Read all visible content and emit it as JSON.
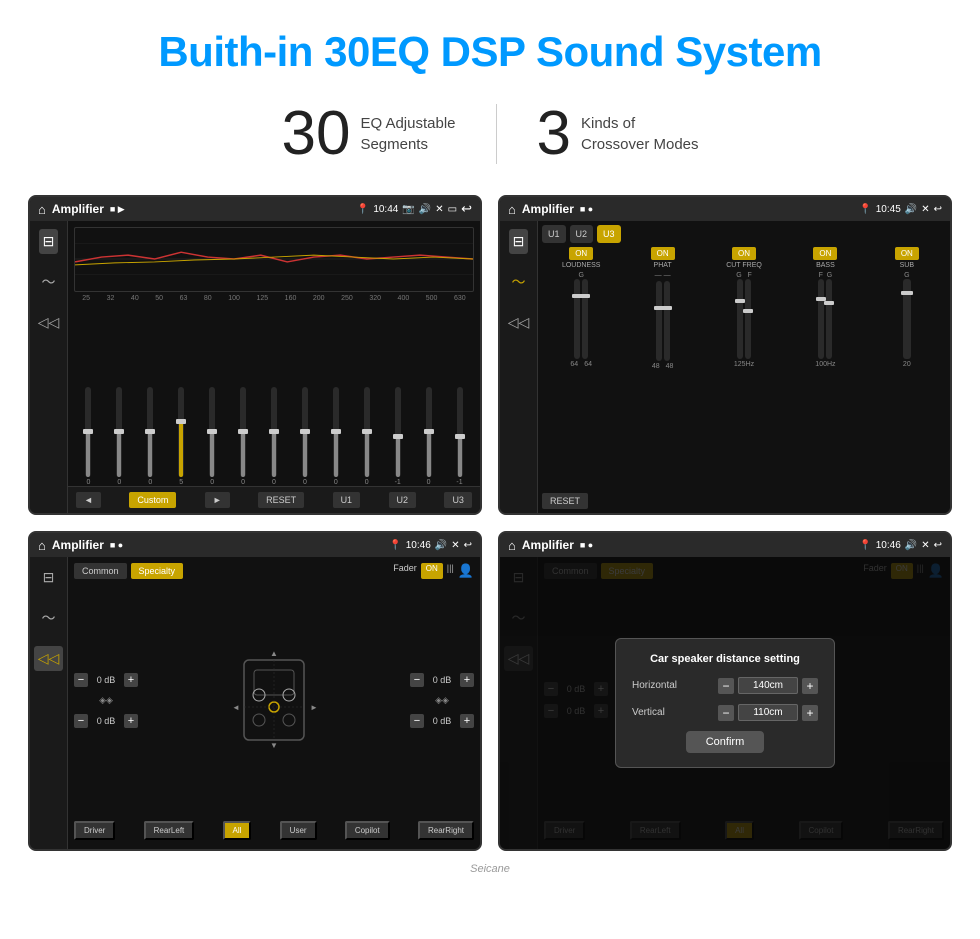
{
  "page": {
    "title": "Buith-in 30EQ DSP Sound System",
    "stats": [
      {
        "number": "30",
        "text": "EQ Adjustable\nSegments"
      },
      {
        "number": "3",
        "text": "Kinds of\nCrossover Modes"
      }
    ]
  },
  "screens": [
    {
      "id": "screen1",
      "status_time": "10:44",
      "app_title": "Amplifier",
      "type": "eq",
      "freq_labels": [
        "25",
        "32",
        "40",
        "50",
        "63",
        "80",
        "100",
        "125",
        "160",
        "200",
        "250",
        "320",
        "400",
        "500",
        "630"
      ],
      "sliders": [
        0,
        0,
        0,
        5,
        0,
        0,
        0,
        0,
        0,
        0,
        -1,
        0,
        -1
      ],
      "bottom_buttons": [
        "◄",
        "Custom",
        "►",
        "RESET",
        "U1",
        "U2",
        "U3"
      ]
    },
    {
      "id": "screen2",
      "status_time": "10:45",
      "app_title": "Amplifier",
      "type": "crossover",
      "preset_buttons": [
        "U1",
        "U2",
        "U3"
      ],
      "active_preset": "U3",
      "channels": [
        "LOUDNESS",
        "PHAT",
        "CUT FREQ",
        "BASS",
        "SUB"
      ],
      "channel_on": [
        true,
        true,
        true,
        true,
        true
      ],
      "reset_label": "RESET"
    },
    {
      "id": "screen3",
      "status_time": "10:46",
      "app_title": "Amplifier",
      "type": "speaker",
      "tabs": [
        "Common",
        "Specialty"
      ],
      "active_tab": "Specialty",
      "fader_label": "Fader",
      "fader_on": true,
      "db_values": [
        "0 dB",
        "0 dB",
        "0 dB",
        "0 dB"
      ],
      "speaker_buttons": [
        "Driver",
        "RearLeft",
        "All",
        "User",
        "Copilot",
        "RearRight"
      ]
    },
    {
      "id": "screen4",
      "status_time": "10:46",
      "app_title": "Amplifier",
      "type": "speaker_dialog",
      "dialog_title": "Car speaker distance setting",
      "horizontal_label": "Horizontal",
      "horizontal_value": "140cm",
      "vertical_label": "Vertical",
      "vertical_value": "110cm",
      "confirm_label": "Confirm",
      "tabs": [
        "Common",
        "Specialty"
      ],
      "active_tab": "Specialty",
      "speaker_buttons": [
        "Driver",
        "RearLeft",
        "All",
        "User",
        "Copilot",
        "RearRight"
      ],
      "db_values": [
        "0 dB",
        "0 dB"
      ]
    }
  ],
  "watermark": "Seicane"
}
